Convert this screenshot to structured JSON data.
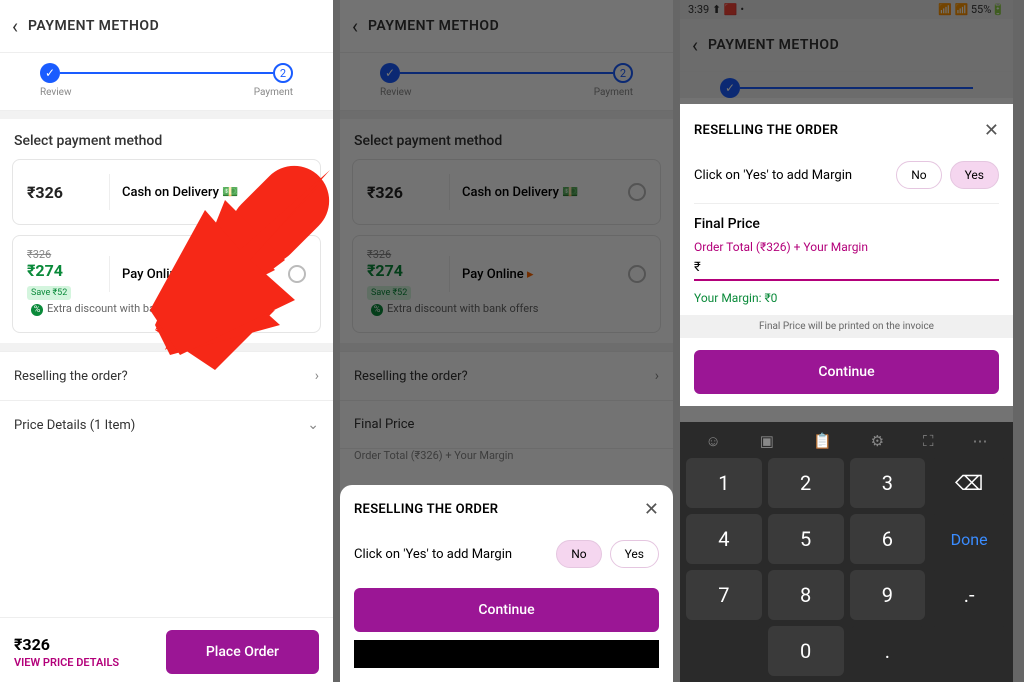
{
  "header": {
    "title": "PAYMENT METHOD"
  },
  "steps": {
    "review": "Review",
    "payment": "Payment",
    "num2": "2"
  },
  "select_title": "Select payment method",
  "cod": {
    "price": "₹326",
    "label": "Cash on Delivery"
  },
  "online": {
    "strike": "₹326",
    "price": "₹274",
    "save": "Save ₹52",
    "label": "Pay Online",
    "bank": "Extra discount with bank offers"
  },
  "resell_row": "Reselling the order?",
  "price_row": "Price Details (1 Item)",
  "footer": {
    "price": "₹326",
    "link": "VIEW PRICE DETAILS",
    "btn": "Place Order"
  },
  "sheet": {
    "title": "RESELLING THE ORDER",
    "msg": "Click on 'Yes' to add Margin",
    "no": "No",
    "yes": "Yes",
    "cont": "Continue"
  },
  "s2": {
    "final": "Final Price",
    "ot": "Order Total (₹326) + Your Margin"
  },
  "s3": {
    "status_time": "3:39",
    "status_batt": "55%",
    "final": "Final Price",
    "ot": "Order Total (₹326) + Your Margin",
    "rupee": "₹",
    "margin": "Your Margin: ₹0",
    "note": "Final Price will be printed on the invoice"
  },
  "keys": {
    "k1": "1",
    "k2": "2",
    "k3": "3",
    "k4": "4",
    "k5": "5",
    "k6": "6",
    "k7": "7",
    "k8": "8",
    "k9": "9",
    "k0": "0",
    "bs": "⌫",
    "done": "Done",
    "dash": ".-",
    "dot": "."
  }
}
